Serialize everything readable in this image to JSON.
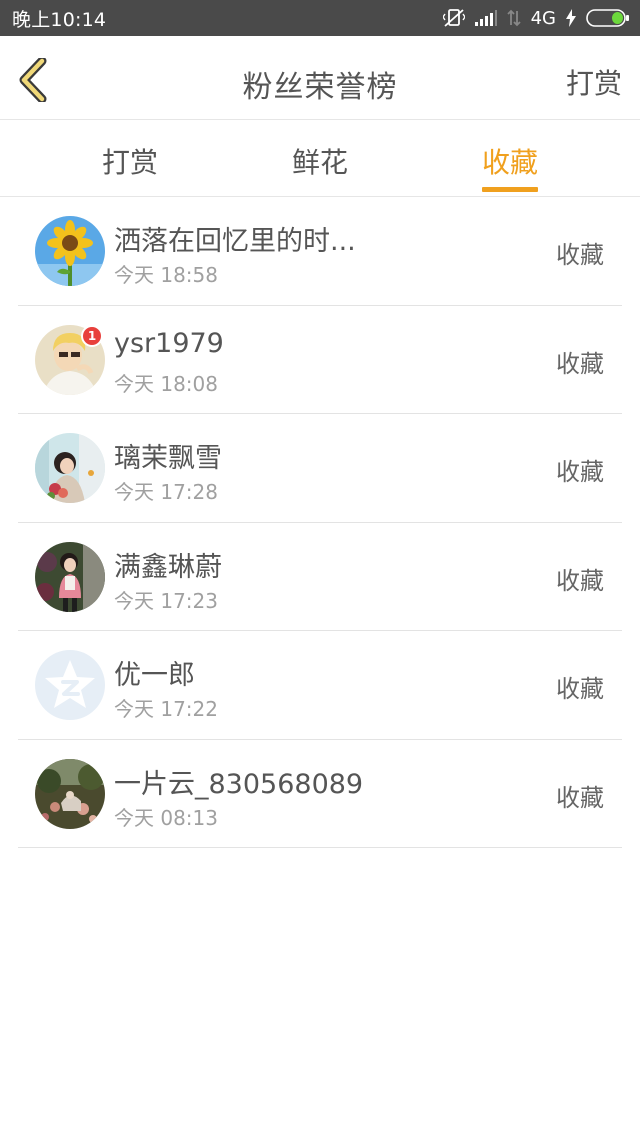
{
  "status_bar": {
    "time": "晚上10:14",
    "network": "4G"
  },
  "header": {
    "title": "粉丝荣誉榜",
    "action_label": "打赏"
  },
  "tabs": [
    {
      "label": "打赏",
      "active": false
    },
    {
      "label": "鲜花",
      "active": false
    },
    {
      "label": "收藏",
      "active": true
    }
  ],
  "colors": {
    "accent": "#f0a01e",
    "back_arrow_fill": "#f0d878",
    "badge": "#e8403c"
  },
  "list": [
    {
      "name": "洒落在回忆里的时...",
      "time": "今天 18:58",
      "action": "收藏",
      "avatar": "sunflower-avatar"
    },
    {
      "name": "ysr1979",
      "time": "今天 18:08",
      "action": "收藏",
      "avatar": "blonde-person-avatar",
      "badge": "1"
    },
    {
      "name": "璃茉飘雪",
      "time": "今天 17:28",
      "action": "收藏",
      "avatar": "girl-with-flowers-avatar"
    },
    {
      "name": "满鑫琳蔚",
      "time": "今天 17:23",
      "action": "收藏",
      "avatar": "girl-outdoor-avatar"
    },
    {
      "name": "优一郎",
      "time": "今天 17:22",
      "action": "收藏",
      "avatar": "default-star-avatar"
    },
    {
      "name": "一片云_830568089",
      "time": "今天 08:13",
      "action": "收藏",
      "avatar": "garden-avatar"
    }
  ]
}
